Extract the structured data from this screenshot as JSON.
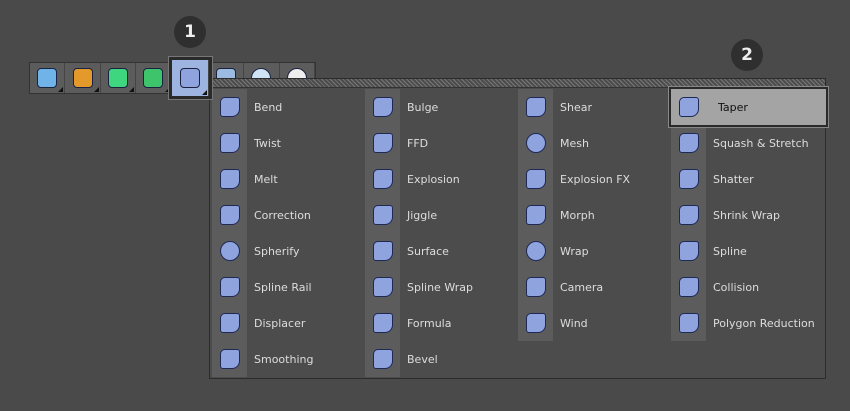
{
  "badges": [
    "1",
    "2"
  ],
  "toolbar": {
    "buttons": [
      {
        "name": "cube",
        "icon": "cube-icon"
      },
      {
        "name": "pen",
        "icon": "pen-icon"
      },
      {
        "name": "subdivision",
        "icon": "subdivision-cube-icon"
      },
      {
        "name": "cloner",
        "icon": "cloner-icon"
      },
      {
        "name": "deformers",
        "icon": "bend-deformer-icon",
        "active": true
      },
      {
        "name": "floor",
        "icon": "floor-icon"
      },
      {
        "name": "camera",
        "icon": "camera-icon"
      },
      {
        "name": "light",
        "icon": "light-icon"
      }
    ]
  },
  "menu": {
    "columns": [
      [
        "Bend",
        "Twist",
        "Melt",
        "Correction",
        "Spherify",
        "Spline Rail",
        "Displacer",
        "Smoothing"
      ],
      [
        "Bulge",
        "FFD",
        "Explosion",
        "Jiggle",
        "Surface",
        "Spline Wrap",
        "Formula",
        "Bevel"
      ],
      [
        "Shear",
        "Mesh",
        "Explosion FX",
        "Morph",
        "Wrap",
        "Camera",
        "Wind"
      ],
      [
        "Taper",
        "Squash & Stretch",
        "Shatter",
        "Shrink Wrap",
        "Spline",
        "Collision",
        "Polygon Reduction"
      ]
    ],
    "highlighted": "Taper"
  },
  "colors": {
    "icon": "#8fa3df",
    "highlight": "#a4a4a4",
    "active_button": "#9db3e0"
  }
}
